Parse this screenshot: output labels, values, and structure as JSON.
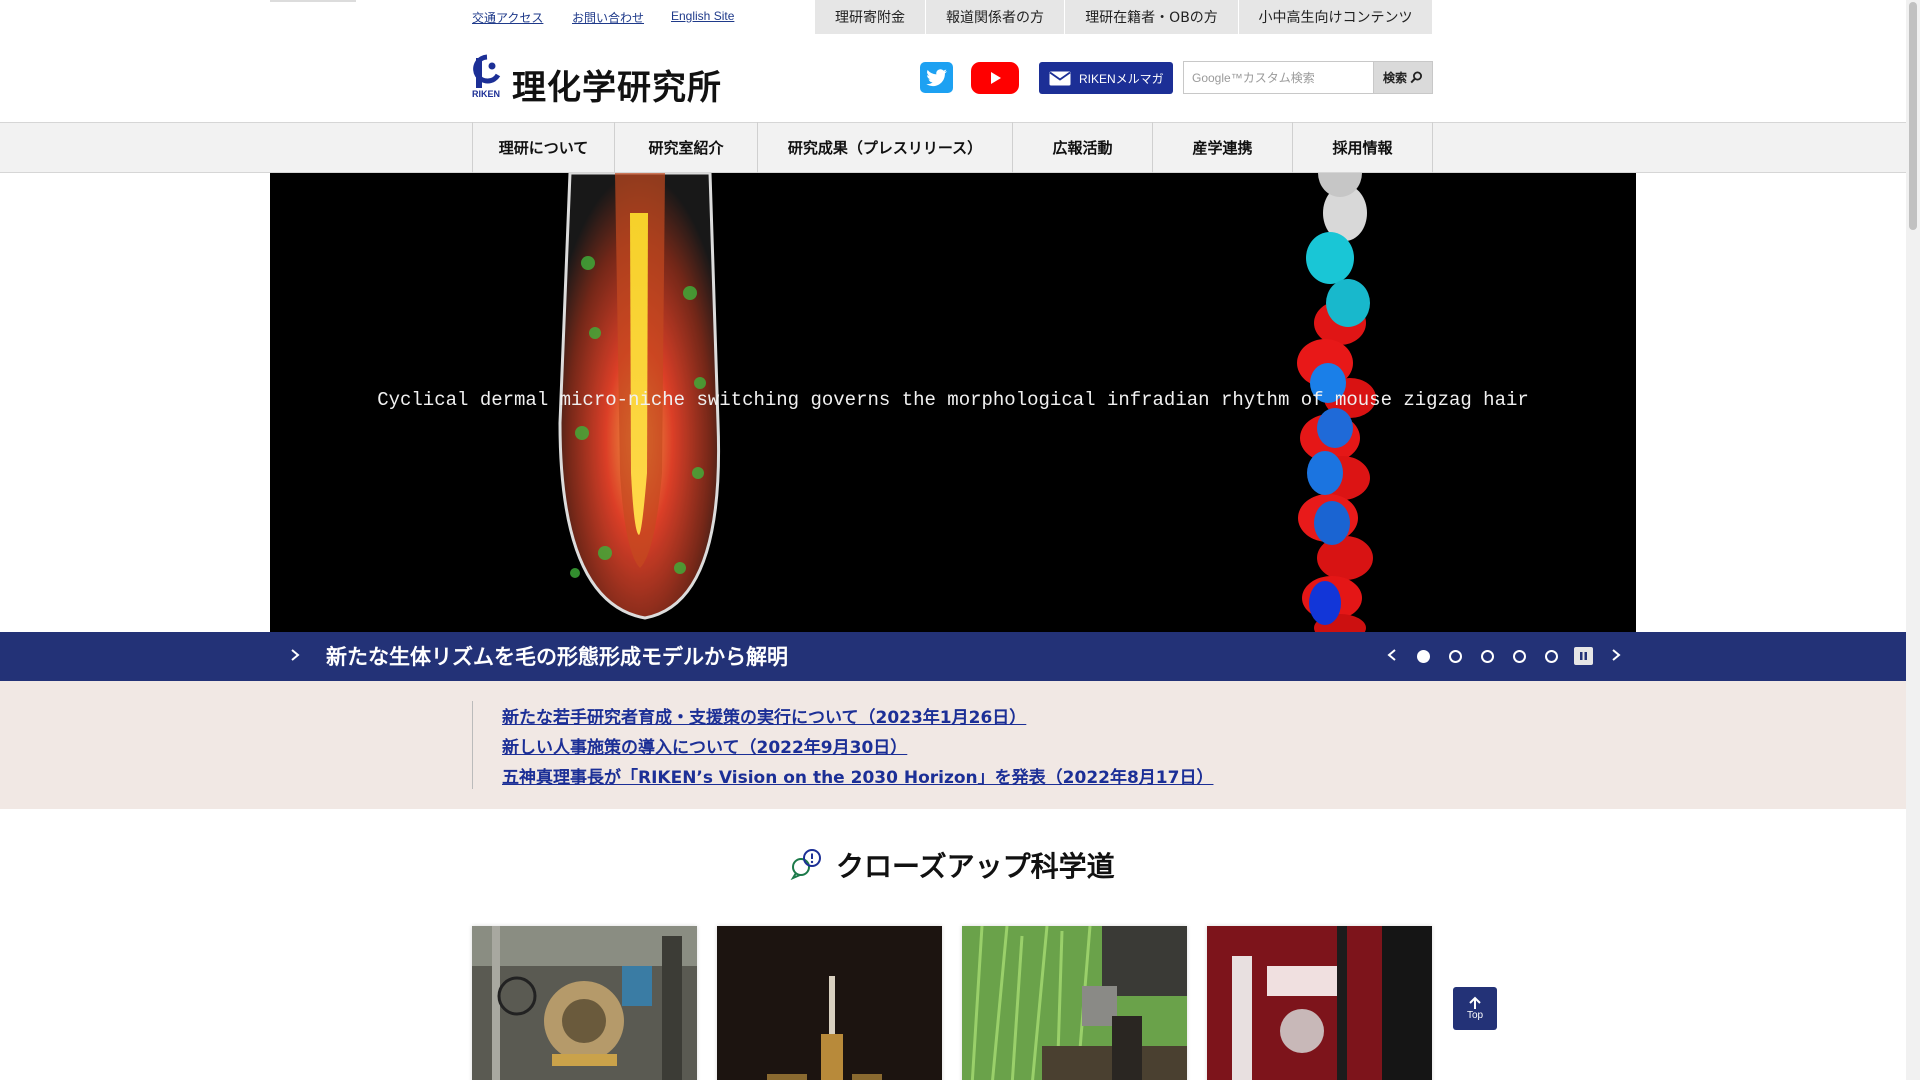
{
  "header": {
    "util_links": [
      "交通アクセス",
      "お問い合わせ",
      "English Site"
    ],
    "gray_tabs": [
      "理研寄附金",
      "報道関係者の方",
      "理研在籍者・OBの方",
      "小中高生向けコンテンツ"
    ],
    "logo_text": "理化学研究所",
    "logo_mark_label": "RIKEN",
    "mailmag_label": "RIKENメルマガ",
    "search_placeholder": "Google™カスタム検索",
    "search_button": "検索"
  },
  "nav": {
    "items": [
      "理研について",
      "研究室紹介",
      "研究成果（プレスリリース）",
      "広報活動",
      "産学連携",
      "採用情報"
    ]
  },
  "hero": {
    "caption": "Cyclical dermal micro-niche switching governs the morphological infradian rhythm of mouse zigzag hair",
    "slide_title": "新たな生体リズムを毛の形態形成モデルから解明",
    "active_slide": 1,
    "slide_count": 5
  },
  "news": {
    "items": [
      "新たな若手研究者育成・支援策の実行について（2023年1月26日）",
      "新しい人事施策の導入について（2022年9月30日）",
      "五神真理事長が「RIKEN’s Vision on the 2030 Horizon」を発表（2022年8月17日）"
    ]
  },
  "closeup": {
    "title": "クローズアップ科学道",
    "card_count": 4
  },
  "top_button": "Top",
  "colors": {
    "brand_navy": "#233277",
    "link_blue": "#1c2f96",
    "twitter": "#1da1f2",
    "youtube": "#ff0000",
    "news_bg": "#f1e8e4"
  },
  "icons": [
    "twitter-icon",
    "youtube-icon",
    "mail-icon",
    "search-icon",
    "chevron-right-icon",
    "chevron-left-icon",
    "pause-icon",
    "speech-bubble-icon",
    "arrow-up-icon"
  ]
}
